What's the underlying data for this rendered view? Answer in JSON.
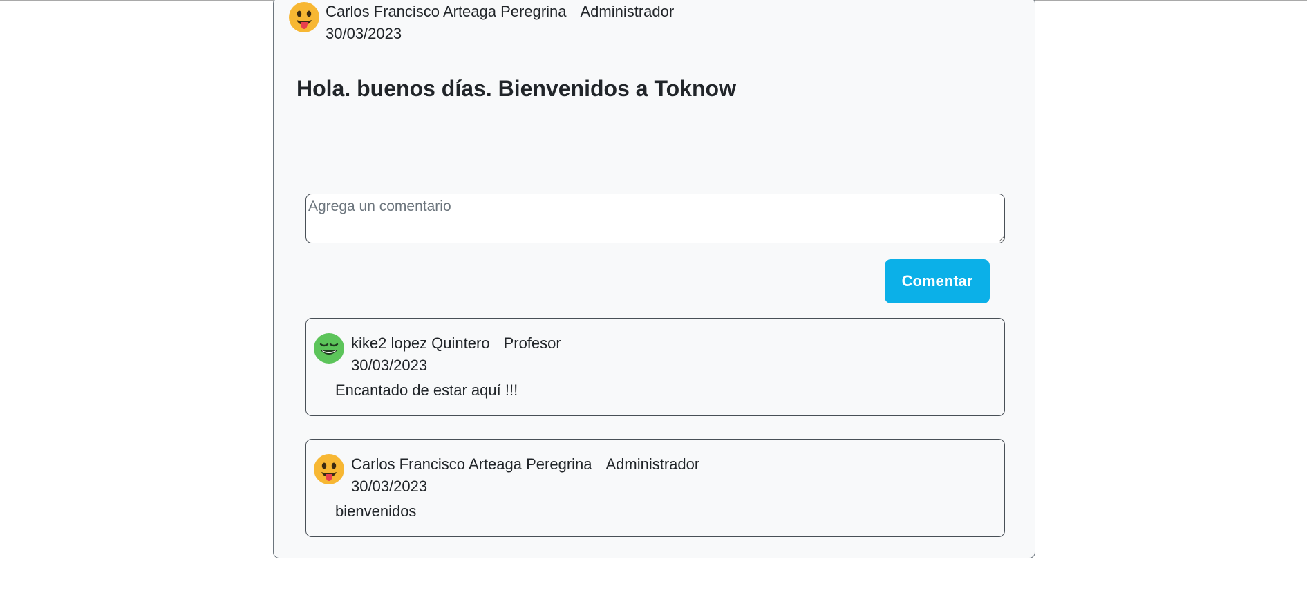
{
  "post": {
    "author_name": "Carlos Francisco Arteaga Peregrina",
    "author_role": "Administrador",
    "date": "30/03/2023",
    "avatar_icon": "tongue-out-emoji-icon",
    "title": "Hola. buenos días. Bienvenidos a Toknow"
  },
  "comment_form": {
    "placeholder": "Agrega un comentario",
    "value": "",
    "submit_label": "Comentar"
  },
  "comments": [
    {
      "author_name": "kike2 lopez Quintero",
      "author_role": "Profesor",
      "date": "30/03/2023",
      "avatar_icon": "grinning-squint-emoji-icon",
      "text": "Encantado de estar aquí !!!"
    },
    {
      "author_name": "Carlos Francisco Arteaga Peregrina",
      "author_role": "Administrador",
      "date": "30/03/2023",
      "avatar_icon": "tongue-out-emoji-icon",
      "text": "bienvenidos"
    }
  ],
  "colors": {
    "accent": "#0bb0e8",
    "card_background": "#f8f9fa",
    "emoji_yellow": "#f7b733",
    "emoji_green": "#5cc45a"
  }
}
